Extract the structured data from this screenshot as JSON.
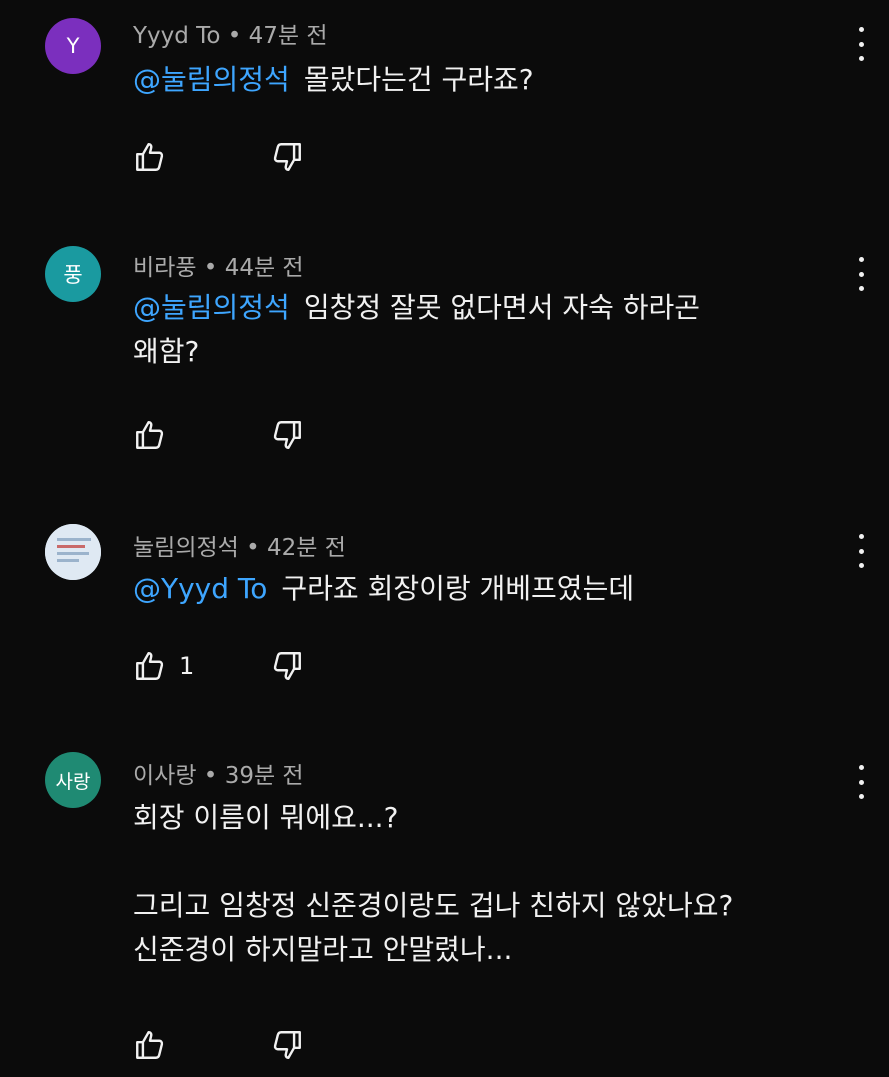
{
  "comments": [
    {
      "avatar_text": "Y",
      "avatar_color": "#7b2fbe",
      "author": "Yyyd To",
      "separator": "•",
      "time": "47분 전",
      "mention": "@눌림의정석",
      "lines": [
        "몰랐다는건 구라죠?"
      ],
      "like_count": ""
    },
    {
      "avatar_text": "풍",
      "avatar_color": "#1a9aa0",
      "author": "비라풍",
      "separator": "•",
      "time": "44분 전",
      "mention": "@눌림의정석",
      "lines": [
        "임창정 잘못 없다면서 자숙 하라곤",
        "왜함?"
      ],
      "like_count": ""
    },
    {
      "avatar_text": "",
      "avatar_color": "#cfe0ee",
      "author": "눌림의정석",
      "separator": "•",
      "time": "42분 전",
      "mention": "@Yyyd To",
      "lines": [
        "구라죠 회장이랑 개베프였는데"
      ],
      "like_count": "1"
    },
    {
      "avatar_text": "사랑",
      "avatar_color": "#1f8a73",
      "author": "이사랑",
      "separator": "•",
      "time": "39분 전",
      "mention": "",
      "lines": [
        "회장 이름이 뭐에요...?",
        "",
        "그리고 임창정 신준경이랑도 겁나 친하지 않았나요?",
        "신준경이 하지말라고 안말렸나..."
      ],
      "like_count": ""
    }
  ],
  "icons": {
    "like": "thumbs-up-icon",
    "dislike": "thumbs-down-icon",
    "more": "more-vert-icon"
  },
  "colors": {
    "background": "#0b0b0b",
    "mention": "#3ea6ff",
    "meta": "#aaaaaa"
  }
}
